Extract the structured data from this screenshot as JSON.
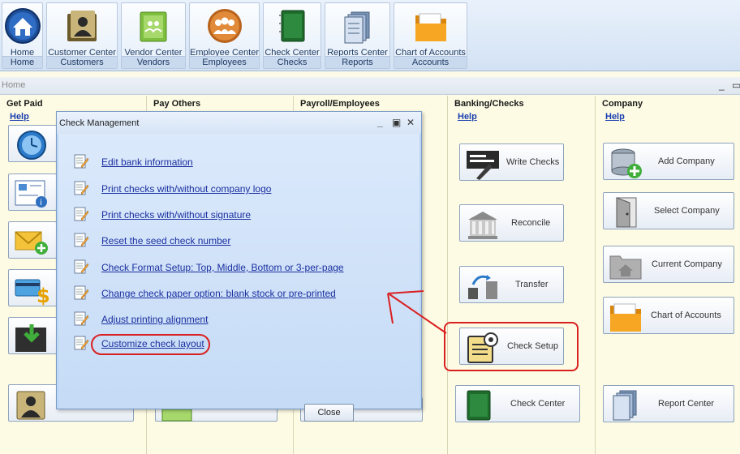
{
  "ribbon": {
    "buttons": [
      {
        "label": "Home",
        "group": "Home",
        "icon": "home-icon"
      },
      {
        "label": "Customer Center",
        "group": "Customers",
        "icon": "customer-folder-icon"
      },
      {
        "label": "Vendor Center",
        "group": "Vendors",
        "icon": "vendor-book-icon"
      },
      {
        "label": "Employee Center",
        "group": "Employees",
        "icon": "employees-icon"
      },
      {
        "label": "Check Center",
        "group": "Checks",
        "icon": "checkbook-icon"
      },
      {
        "label": "Reports Center",
        "group": "Reports",
        "icon": "reports-icon"
      },
      {
        "label": "Chart of Accounts",
        "group": "Accounts",
        "icon": "accounts-folder-icon"
      }
    ]
  },
  "address": {
    "crumb": "Home",
    "minimize": "_",
    "restore": "▭"
  },
  "columns": {
    "get_paid": {
      "title": "Get Paid",
      "help": "Help"
    },
    "pay_others": {
      "title": "Pay Others"
    },
    "payroll": {
      "title": "Payroll/Employees"
    },
    "banking": {
      "title": "Banking/Checks",
      "help": "Help",
      "tiles": [
        "Write Checks",
        "Reconcile",
        "Transfer",
        "Check Setup",
        "Check Center"
      ]
    },
    "company": {
      "title": "Company",
      "help": "Help",
      "tiles": [
        "Add Company",
        "Select Company",
        "Current Company",
        "Chart of Accounts",
        "Report Center"
      ]
    }
  },
  "dialog": {
    "title": "Check Management",
    "controls": {
      "minimize": "_",
      "maximize": "▣",
      "close": "✕"
    },
    "options": [
      "Edit bank information",
      "Print checks with/without company logo",
      "Print checks with/without signature",
      "Reset the seed check number",
      "Check Format Setup: Top, Middle, Bottom or 3-per-page",
      "Change check paper option: blank stock or pre-printed",
      "Adjust printing alignment",
      "Customize check layout"
    ],
    "close_label": "Close"
  },
  "colors": {
    "annotation": "#d92020",
    "link": "#1b2fa0",
    "dialog_bg": "#c5dbf6"
  }
}
